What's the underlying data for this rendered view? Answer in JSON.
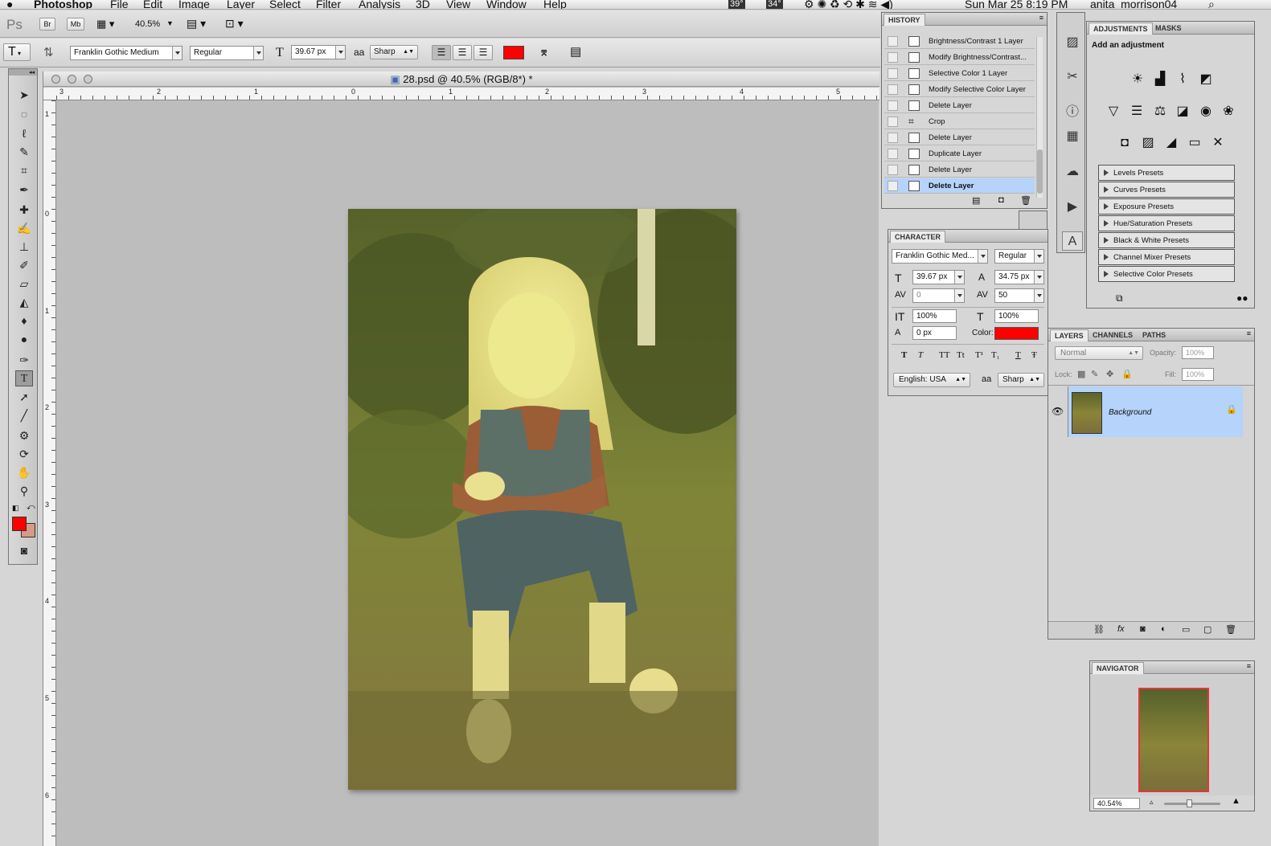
{
  "menubar": {
    "apple": "",
    "app": "Photoshop",
    "menus": [
      "File",
      "Edit",
      "Image",
      "Layer",
      "Select",
      "Filter",
      "Analysis",
      "3D",
      "View",
      "Window",
      "Help"
    ],
    "status": {
      "temp1": "39°",
      "temp2": "34°",
      "datetime": "Sun Mar 25  8:19 PM",
      "user": "anita_morrison04"
    }
  },
  "appbar": {
    "ps_logo": "Ps",
    "br": "Br",
    "mb": "Mb",
    "zoom": "40.5%"
  },
  "options": {
    "tool_icon": "T",
    "font_family": "Franklin Gothic Medium",
    "font_style": "Regular",
    "font_size": "39.67 px",
    "aa_label": "aa",
    "antialias": "Sharp",
    "text_color": "#ff0000"
  },
  "document": {
    "title": "28.psd @ 40.5% (RGB/8*) *",
    "ruler_h": [
      "3",
      "2",
      "1",
      "0",
      "1",
      "2",
      "3",
      "4",
      "5"
    ],
    "ruler_v": [
      "1",
      "0",
      "1",
      "2",
      "3",
      "4",
      "5",
      "6"
    ]
  },
  "history": {
    "title": "HISTORY",
    "items": [
      "Brightness/Contrast 1 Layer",
      "Modify Brightness/Contrast...",
      "Selective Color 1 Layer",
      "Modify Selective Color Layer",
      "Delete Layer",
      "Crop",
      "Delete Layer",
      "Duplicate Layer",
      "Delete Layer",
      "Delete Layer"
    ],
    "selected_index": 9
  },
  "character": {
    "title": "CHARACTER",
    "font_family": "Franklin Gothic Med...",
    "font_style": "Regular",
    "size": "39.67 px",
    "leading": "34.75 px",
    "kerning": "0",
    "tracking": "50",
    "v_scale": "100%",
    "h_scale": "100%",
    "baseline": "0 px",
    "color_label": "Color:",
    "language": "English: USA",
    "antialias": "Sharp",
    "style_buttons": [
      "T",
      "T",
      "TT",
      "Tt",
      "T¹",
      "T₁",
      "T",
      "Ŧ"
    ]
  },
  "adjustments": {
    "tabs": [
      "ADJUSTMENTS",
      "MASKS"
    ],
    "heading": "Add an adjustment",
    "presets": [
      "Levels Presets",
      "Curves Presets",
      "Exposure Presets",
      "Hue/Saturation Presets",
      "Black & White Presets",
      "Channel Mixer Presets",
      "Selective Color Presets"
    ]
  },
  "layers": {
    "tabs": [
      "LAYERS",
      "CHANNELS",
      "PATHS"
    ],
    "blend_mode": "Normal",
    "opacity_label": "Opacity:",
    "opacity": "100%",
    "lock_label": "Lock:",
    "fill_label": "Fill:",
    "fill": "100%",
    "layer_name": "Background"
  },
  "navigator": {
    "title": "NAVIGATOR",
    "zoom": "40.54%"
  },
  "colors": {
    "foreground": "#ff0000",
    "background": "#d79a86",
    "selection": "#b5d3fb"
  }
}
